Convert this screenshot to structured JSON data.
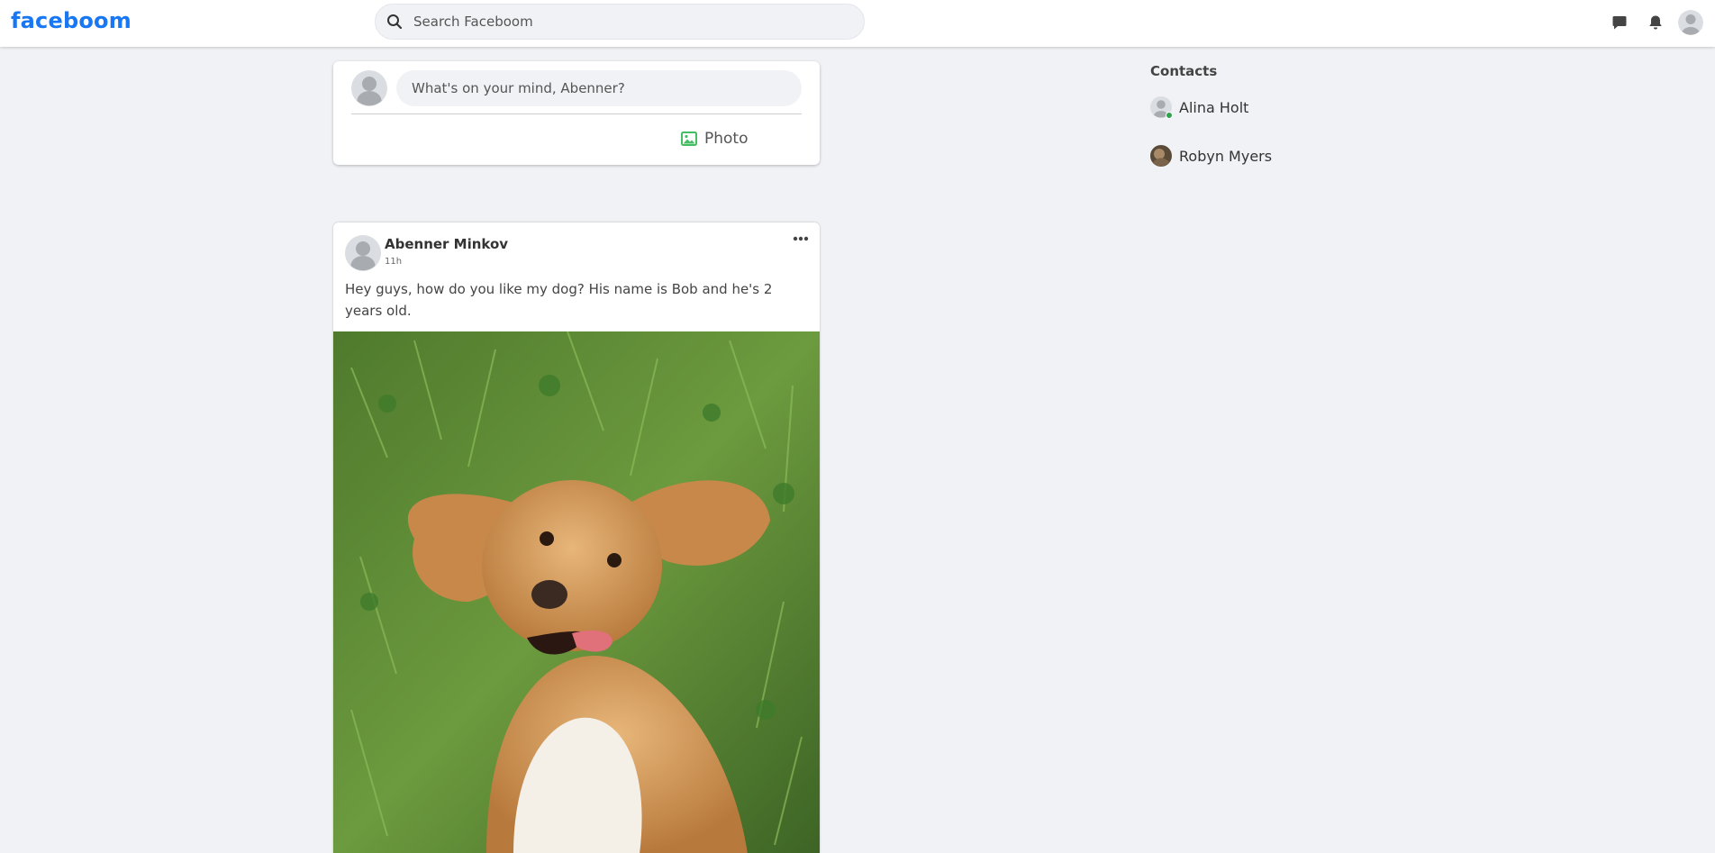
{
  "app": {
    "logo": "faceboom",
    "brand_color": "#1877f2",
    "background_color": "#f0f2f5"
  },
  "header": {
    "search_placeholder": "Search Faceboom",
    "icons": [
      "messenger-icon",
      "bell-icon",
      "avatar"
    ]
  },
  "composer": {
    "prompt": "What's on your mind, Abenner?",
    "photo_label": "Photo",
    "photo_icon_color": "#45bd62"
  },
  "post": {
    "author": "Abenner Minkov",
    "time": "11h",
    "text": "Hey guys, how do you like my dog? His name is Bob and he's 2 years old.",
    "image_subject": "cocker spaniel puppy lying on its back in grass"
  },
  "contacts": {
    "heading": "Contacts",
    "items": [
      {
        "name": "Alina Holt",
        "online": true
      },
      {
        "name": "Robyn Myers",
        "online": false
      }
    ],
    "online_color": "#31a24c"
  }
}
